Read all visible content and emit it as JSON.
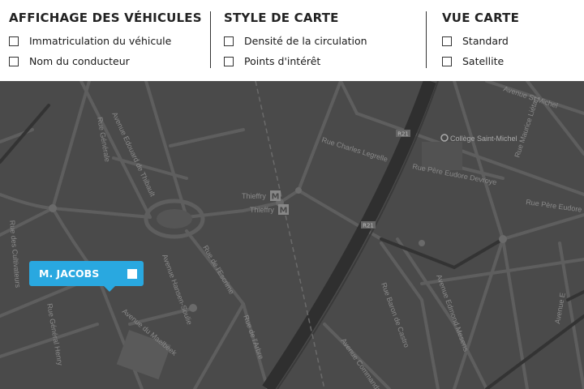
{
  "panel": {
    "groups": [
      {
        "title": "AFFICHAGE DES VÉHICULES",
        "options": [
          "Immatriculation du véhicule",
          "Nom du conducteur"
        ]
      },
      {
        "title": "STYLE DE CARTE",
        "options": [
          "Densité de la circulation",
          "Points d'intérêt"
        ]
      },
      {
        "title": "VUE CARTE",
        "options": [
          "Standard",
          "Satellite"
        ]
      }
    ]
  },
  "map": {
    "colors": {
      "background": "#4a4a4a",
      "road": "#5e5e5e",
      "major_road": "#2f2f2f",
      "label": "#9a9a9a",
      "marker": "#29a8e0"
    },
    "labels": {
      "rue_generale": "Rue Générale",
      "avenue_edouard": "Avenue Edouard de Thibault",
      "rue_charles": "Rue Charles Legrelle",
      "rue_pere_eudore": "Rue Père Eudore Devroye",
      "rue_pere_eudore2": "Rue Père Eudore",
      "avenue_st_michel": "Avenue St Michel",
      "college": "Collège Saint-Michel",
      "rue_maurice": "Rue Maurice Liétart",
      "thieffry1": "Thieffry",
      "thieffry2": "Thieffry",
      "metro": "M",
      "rue_generale_henry": "Rue Général Henry",
      "avenue_hansen": "Avenue Hansen-Soulie",
      "rue_baron": "Rue Baron de Castro",
      "avenue_edmond": "Avenue Edmond Mesens",
      "avenue_e": "Avenue E",
      "avenue_du_maelbeek": "Avenue du Maelbeek",
      "rue_des_cultivateurs": "Rue des Cultivateurs",
      "rue_de_lenvelle": "Rue de l'Escrime",
      "avenue_commandant": "Avenue Commandant",
      "rue_de_larbre": "Rue de l'Arbre",
      "r21": "R21",
      "r21b": "R21"
    },
    "marker": {
      "label": "M. JACOBS"
    }
  }
}
